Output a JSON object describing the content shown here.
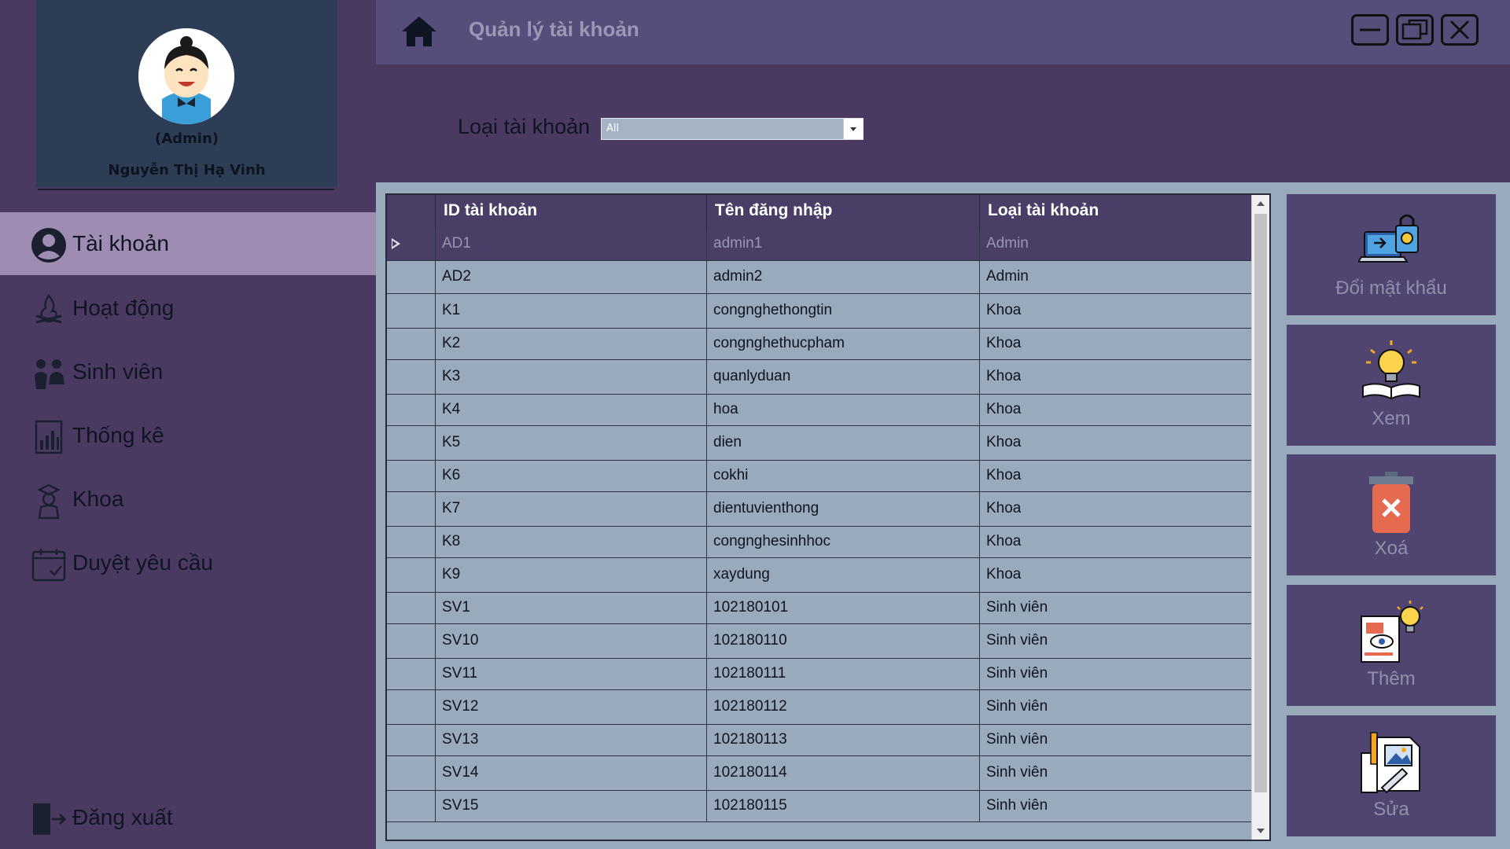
{
  "header": {
    "title": "Quản lý tài khoản"
  },
  "profile": {
    "role": "(Admin)",
    "name": "Nguyễn Thị Hạ Vinh"
  },
  "sidebar": {
    "items": [
      {
        "label": "Tài khoản",
        "icon": "user-icon",
        "active": true
      },
      {
        "label": "Hoạt động",
        "icon": "campfire-icon",
        "active": false
      },
      {
        "label": "Sinh viên",
        "icon": "students-icon",
        "active": false
      },
      {
        "label": "Thống kê",
        "icon": "statistics-icon",
        "active": false
      },
      {
        "label": "Khoa",
        "icon": "faculty-icon",
        "active": false
      },
      {
        "label": "Duyệt yêu cầu",
        "icon": "calendar-check-icon",
        "active": false
      }
    ],
    "logout_label": "Đăng xuất"
  },
  "filter": {
    "label": "Loại tài khoản",
    "selected": "All"
  },
  "table": {
    "columns": [
      "ID tài khoản",
      "Tên đăng nhập",
      "Loại tài khoản"
    ],
    "rows": [
      [
        "AD1",
        "admin1",
        "Admin"
      ],
      [
        "AD2",
        "admin2",
        "Admin"
      ],
      [
        "K1",
        "congnghethongtin",
        "Khoa"
      ],
      [
        "K2",
        "congnghethucpham",
        "Khoa"
      ],
      [
        "K3",
        "quanlyduan",
        "Khoa"
      ],
      [
        "K4",
        "hoa",
        "Khoa"
      ],
      [
        "K5",
        "dien",
        "Khoa"
      ],
      [
        "K6",
        "cokhi",
        "Khoa"
      ],
      [
        "K7",
        "dientuvienthong",
        "Khoa"
      ],
      [
        "K8",
        "congnghesinhhoc",
        "Khoa"
      ],
      [
        "K9",
        "xaydung",
        "Khoa"
      ],
      [
        "SV1",
        "102180101",
        "Sinh viên"
      ],
      [
        "SV10",
        "102180110",
        "Sinh viên"
      ],
      [
        "SV11",
        "102180111",
        "Sinh viên"
      ],
      [
        "SV12",
        "102180112",
        "Sinh viên"
      ],
      [
        "SV13",
        "102180113",
        "Sinh viên"
      ],
      [
        "SV14",
        "102180114",
        "Sinh viên"
      ],
      [
        "SV15",
        "102180115",
        "Sinh viên"
      ]
    ],
    "selected_row": 0
  },
  "actions": [
    {
      "label": "Đổi mật khẩu",
      "icon": "laptop-lock-icon"
    },
    {
      "label": "Xem",
      "icon": "lightbulb-book-icon"
    },
    {
      "label": "Xoá",
      "icon": "trash-icon"
    },
    {
      "label": "Thêm",
      "icon": "clipboard-idea-icon"
    },
    {
      "label": "Sửa",
      "icon": "image-edit-icon"
    }
  ],
  "colors": {
    "sidebar_bg": "#4a3a62",
    "active_nav": "#9e8cb2",
    "header_bg": "#574d7a",
    "grid_bg": "#9aaabd",
    "selected_row": "#4b3e66"
  }
}
